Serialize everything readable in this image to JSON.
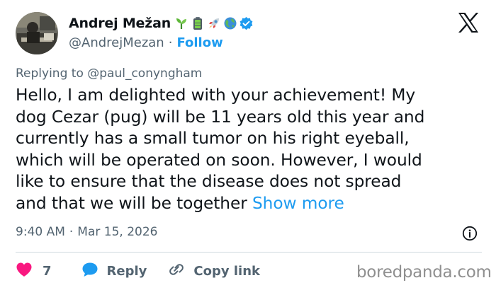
{
  "author": {
    "name": "Andrej Mežan",
    "handle": "@AndrejMezan",
    "separator": "·",
    "follow_label": "Follow",
    "emoji_icons": [
      "seedling-icon",
      "battery-icon",
      "rocket-icon",
      "globe-icon"
    ],
    "verified_icon": "verified-badge-icon",
    "verified_color": "#1d9bf0"
  },
  "reply_context": {
    "prefix": "Replying to",
    "handle": "@paul_conyngham"
  },
  "tweet": {
    "text": "Hello, I am delighted with your achievement! My\ndog Cezar (pug) will be 11 years old this year and\ncurrently has a small tumor on his right eyeball,\nwhich will be operated on soon. However, I would\nlike to ensure that the disease does not spread\nand that we will be together ",
    "show_more_label": "Show more"
  },
  "meta": {
    "time": "9:40 AM",
    "separator": "·",
    "date": "Mar 15, 2026"
  },
  "actions": {
    "like_count": "7",
    "reply_label": "Reply",
    "copy_link_label": "Copy link"
  },
  "watermark": "boredpanda.com",
  "colors": {
    "accent": "#1d9bf0",
    "like": "#f91880",
    "muted": "#536471",
    "text": "#0f1419"
  }
}
